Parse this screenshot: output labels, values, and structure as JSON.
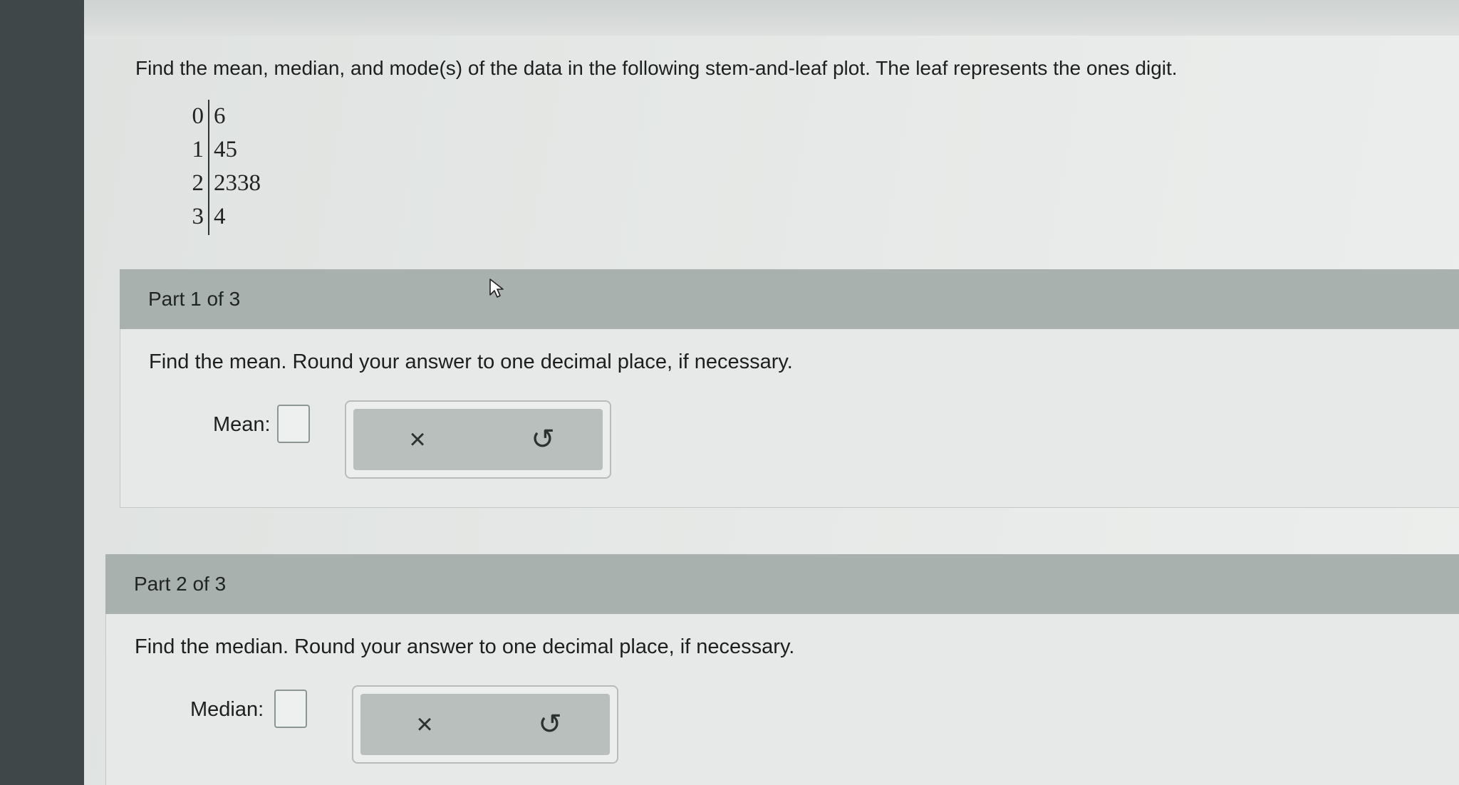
{
  "question": {
    "text": "Find the mean, median, and mode(s) of the data in the following stem-and-leaf plot. The leaf represents the ones digit."
  },
  "stem_leaf": [
    {
      "stem": "0",
      "leaves": "6"
    },
    {
      "stem": "1",
      "leaves": "45"
    },
    {
      "stem": "2",
      "leaves": "2338"
    },
    {
      "stem": "3",
      "leaves": "4"
    }
  ],
  "parts": [
    {
      "header": "Part 1 of 3",
      "instruction": "Find the mean. Round your answer to one decimal place, if necessary.",
      "answer_label": "Mean:",
      "answer_value": ""
    },
    {
      "header": "Part 2 of 3",
      "instruction": "Find the median. Round your answer to one decimal place, if necessary.",
      "answer_label": "Median:",
      "answer_value": ""
    }
  ],
  "tools": {
    "clear_glyph": "×",
    "undo_glyph": "↺"
  },
  "icons": {
    "clear": "close-icon",
    "undo": "undo-icon",
    "pointer": "mouse-pointer-icon"
  }
}
